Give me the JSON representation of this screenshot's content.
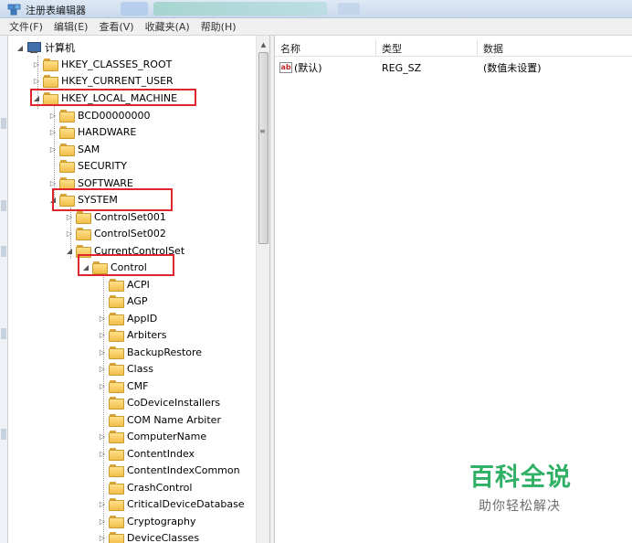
{
  "window": {
    "title": "注册表编辑器"
  },
  "menu": [
    "文件(F)",
    "编辑(E)",
    "查看(V)",
    "收藏夹(A)",
    "帮助(H)"
  ],
  "tree": {
    "root": "计算机",
    "items": [
      "HKEY_CLASSES_ROOT",
      "HKEY_CURRENT_USER",
      "HKEY_LOCAL_MACHINE",
      "BCD00000000",
      "HARDWARE",
      "SAM",
      "SECURITY",
      "SOFTWARE",
      "SYSTEM",
      "ControlSet001",
      "ControlSet002",
      "CurrentControlSet",
      "Control",
      "ACPI",
      "AGP",
      "AppID",
      "Arbiters",
      "BackupRestore",
      "Class",
      "CMF",
      "CoDeviceInstallers",
      "COM Name Arbiter",
      "ComputerName",
      "ContentIndex",
      "ContentIndexCommon",
      "CrashControl",
      "CriticalDeviceDatabase",
      "Cryptography",
      "DeviceClasses"
    ]
  },
  "list": {
    "columns": [
      "名称",
      "类型",
      "数据"
    ],
    "rows": [
      {
        "name": "(默认)",
        "type": "REG_SZ",
        "data": "(数值未设置)"
      }
    ]
  },
  "watermark": {
    "title": "百科全说",
    "subtitle": "助你轻松解决"
  },
  "colors": {
    "highlight_box": "#e0262d",
    "watermark_green": "#2fb064"
  }
}
